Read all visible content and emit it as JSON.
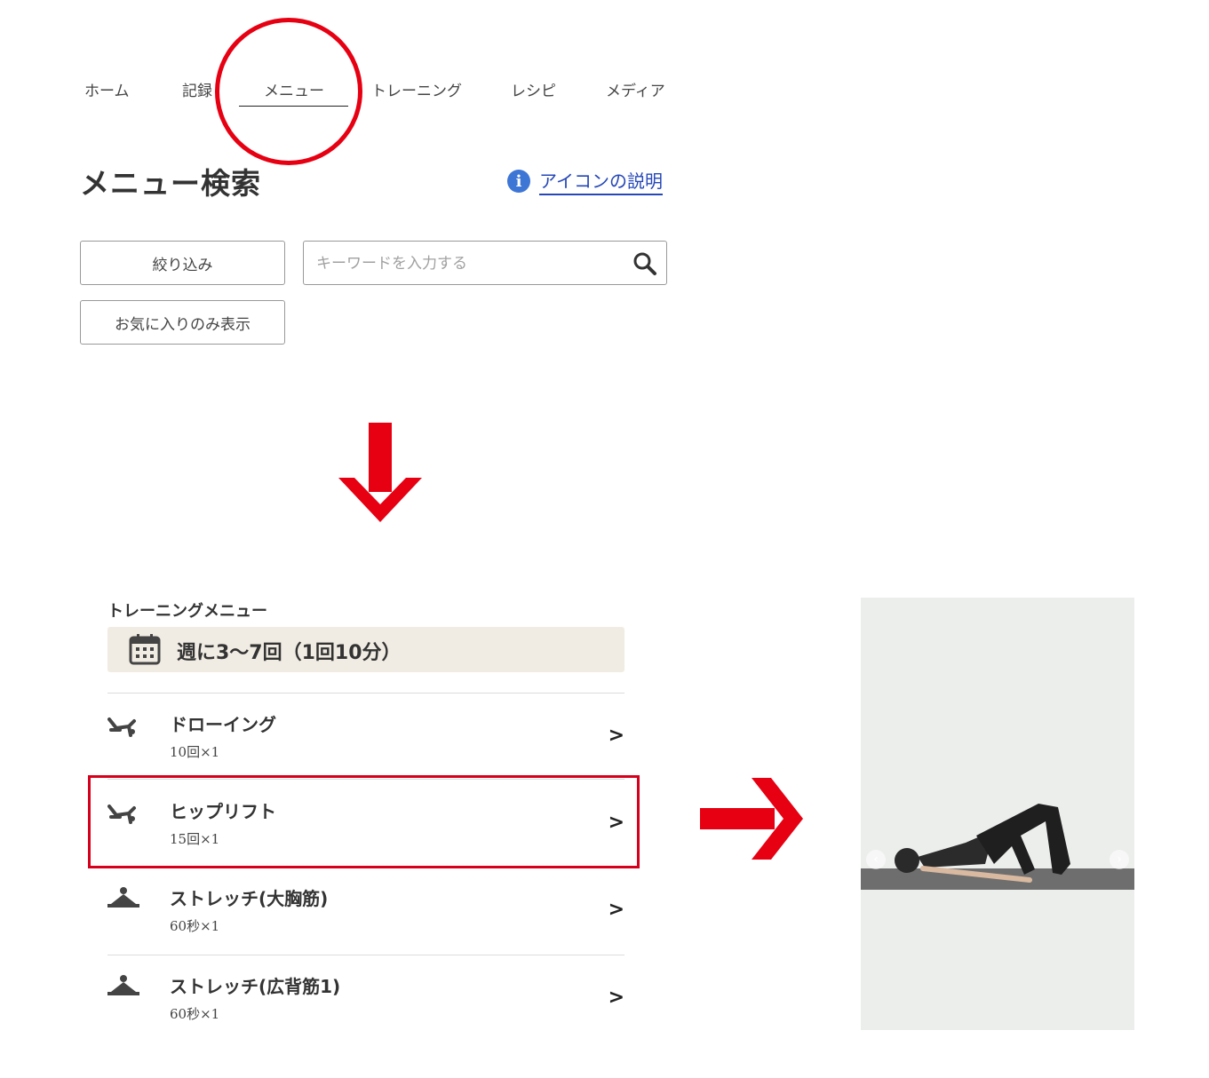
{
  "nav": {
    "items": [
      {
        "label": "ホーム"
      },
      {
        "label": "記録"
      },
      {
        "label": "メニュー"
      },
      {
        "label": "トレーニング"
      },
      {
        "label": "レシピ"
      },
      {
        "label": "メディア"
      }
    ],
    "active_index": 2
  },
  "page": {
    "title": "メニュー検索",
    "icon_help_label": "アイコンの説明"
  },
  "filters": {
    "narrow_button": "絞り込み",
    "favorites_button": "お気に入りのみ表示",
    "search_placeholder": "キーワードを入力する"
  },
  "training": {
    "section_title": "トレーニングメニュー",
    "frequency": "週に3〜7回（1回10分）",
    "exercises": [
      {
        "name": "ドローイング",
        "reps": "10回×1",
        "icon": "floor-exercise-icon"
      },
      {
        "name": "ヒップリフト",
        "reps": "15回×1",
        "icon": "floor-exercise-icon"
      },
      {
        "name": "ストレッチ(大胸筋)",
        "reps": "60秒×1",
        "icon": "stretch-icon"
      },
      {
        "name": "ストレッチ(広背筋1)",
        "reps": "60秒×1",
        "icon": "stretch-icon"
      }
    ],
    "chevron": ">"
  },
  "colors": {
    "accent_red": "#e60012",
    "link_blue": "#2547b8",
    "frequency_bg": "#f1ece3"
  }
}
